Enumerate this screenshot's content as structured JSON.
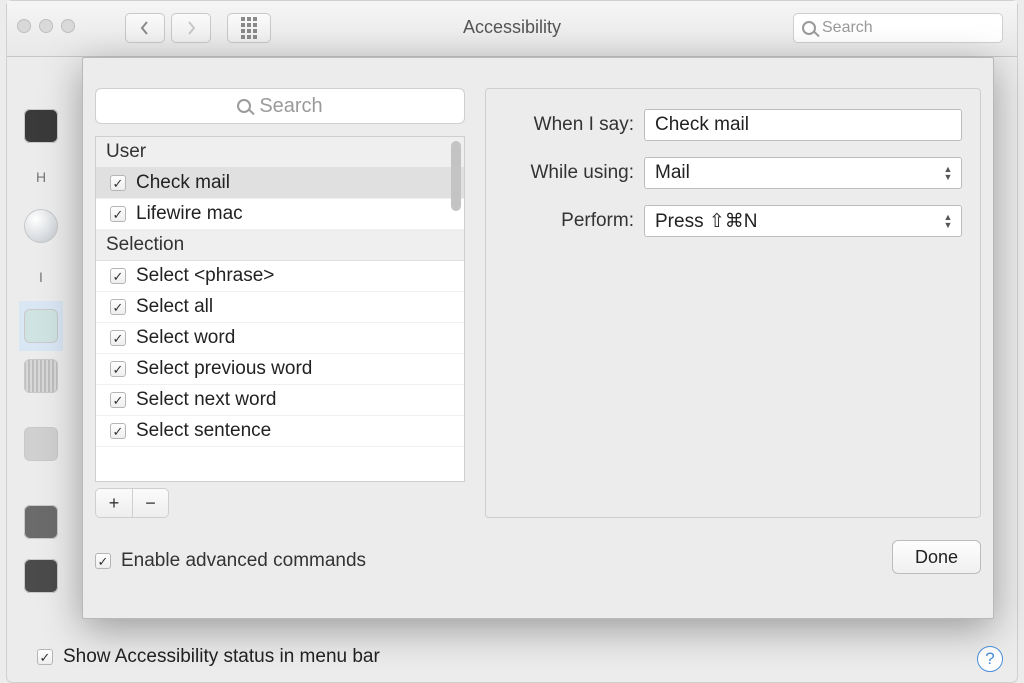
{
  "window": {
    "title": "Accessibility",
    "toolbar_search_placeholder": "Search"
  },
  "bg_sidebar": {
    "label_h": "H",
    "label_i": "I"
  },
  "sheet": {
    "search_placeholder": "Search",
    "groups": [
      {
        "name": "User",
        "items": [
          {
            "label": "Check mail",
            "checked": true,
            "selected": true
          },
          {
            "label": "Lifewire mac",
            "checked": true,
            "selected": false
          }
        ]
      },
      {
        "name": "Selection",
        "items": [
          {
            "label": "Select <phrase>",
            "checked": true
          },
          {
            "label": "Select all",
            "checked": true
          },
          {
            "label": "Select word",
            "checked": true
          },
          {
            "label": "Select previous word",
            "checked": true
          },
          {
            "label": "Select next word",
            "checked": true
          },
          {
            "label": "Select sentence",
            "checked": true
          }
        ]
      }
    ],
    "add_label": "+",
    "remove_label": "−",
    "enable_advanced_label": "Enable advanced commands",
    "enable_advanced_checked": true,
    "form": {
      "when_i_say_label": "When I say:",
      "when_i_say_value": "Check mail",
      "while_using_label": "While using:",
      "while_using_value": "Mail",
      "perform_label": "Perform:",
      "perform_value": "Press ⇧⌘N"
    },
    "done_label": "Done"
  },
  "menubar": {
    "show_status_label": "Show Accessibility status in menu bar",
    "checked": true
  },
  "help_label": "?"
}
